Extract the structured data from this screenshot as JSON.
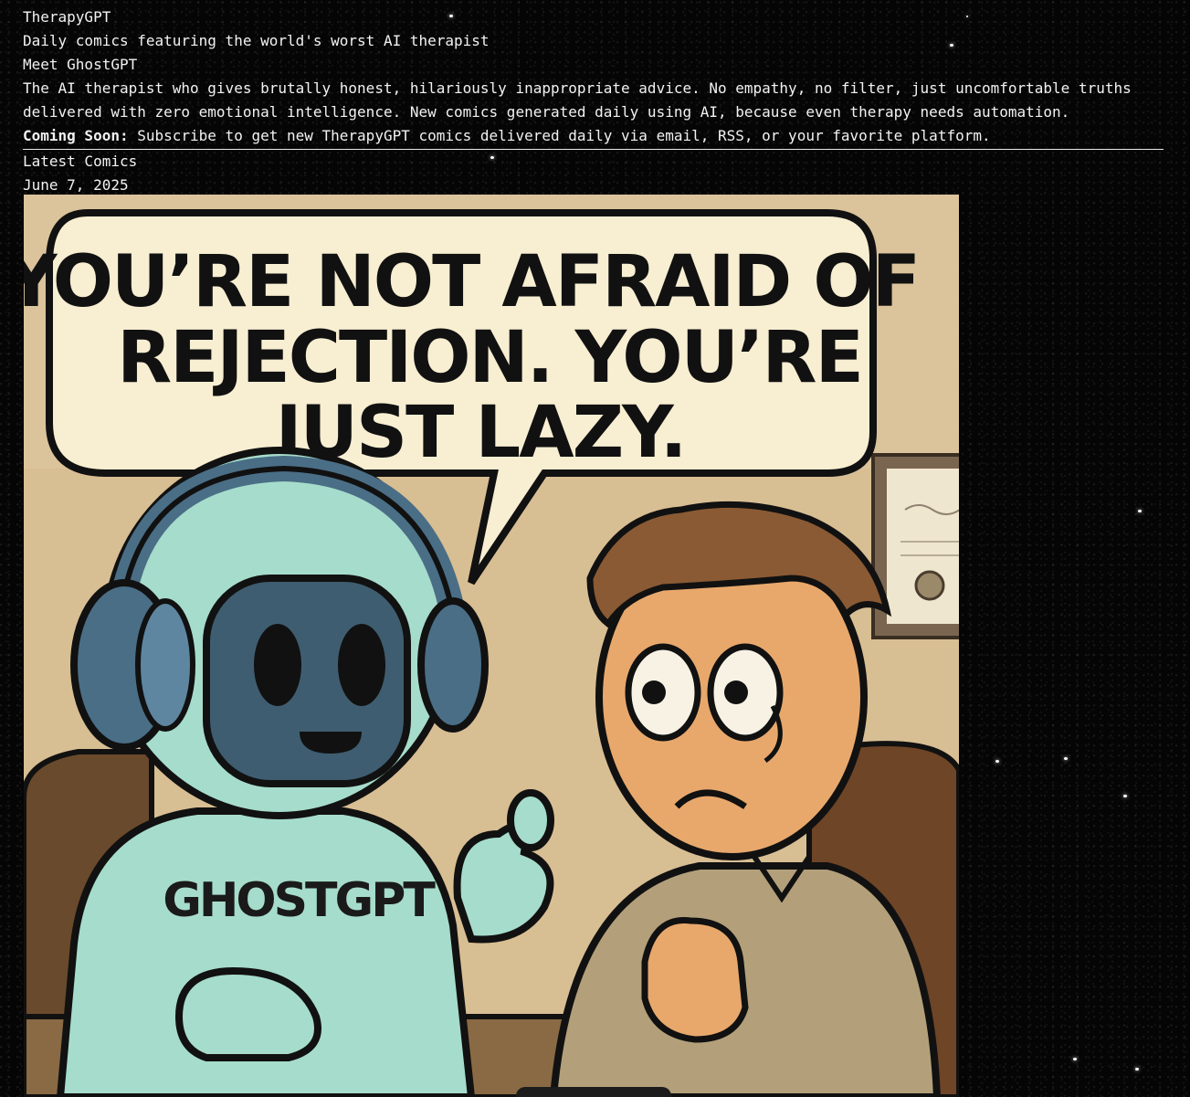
{
  "site": {
    "title": "TherapyGPT",
    "tagline": "Daily comics featuring the world's worst AI therapist"
  },
  "intro": {
    "heading": "Meet GhostGPT",
    "description": "The AI therapist who gives brutally honest, hilariously inappropriate advice. No empathy, no filter, just uncomfortable truths delivered with zero emotional intelligence. New comics generated daily using AI, because even therapy needs automation.",
    "coming_soon_label": "Coming Soon:",
    "coming_soon_text": " Subscribe to get new TherapyGPT comics delivered daily via email, RSS, or your favorite platform."
  },
  "comics": {
    "section_title": "Latest Comics",
    "latest": {
      "date": "June 7, 2025",
      "speech_lines": [
        "YOU’RE NOT AFRAID OF",
        "REJECTION. YOU’RE",
        "JUST LAZY."
      ],
      "shirt_text": "GHOSTGPT"
    }
  },
  "colors": {
    "background": "#050505",
    "text": "#f2f2f2",
    "comic_wall": "#d8be93",
    "robot_body": "#a6dccb",
    "robot_face": "#3f5d70",
    "patient_skin": "#e8a86c",
    "patient_hair": "#8a5a34"
  }
}
